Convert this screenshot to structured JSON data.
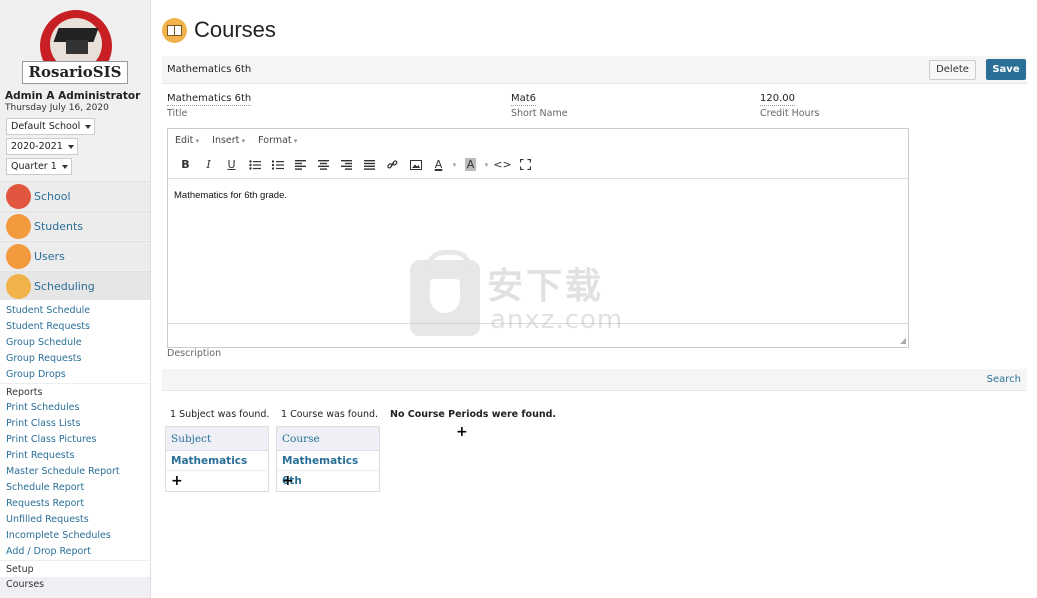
{
  "app": {
    "logo_text": "RosarioSIS"
  },
  "user": {
    "name": "Admin A Administrator",
    "date": "Thursday July 16, 2020"
  },
  "selects": {
    "school": "Default School",
    "year": "2020-2021",
    "quarter": "Quarter 1"
  },
  "menu": {
    "items": [
      {
        "label": "School",
        "icon": "school-icon",
        "color": "#e2553f"
      },
      {
        "label": "Students",
        "icon": "students-icon",
        "color": "#f39a3e"
      },
      {
        "label": "Users",
        "icon": "users-icon",
        "color": "#f39a3e"
      },
      {
        "label": "Scheduling",
        "icon": "scheduling-icon",
        "color": "#f2b24b"
      }
    ],
    "scheduling_links": [
      "Student Schedule",
      "Student Requests",
      "Group Schedule",
      "Group Requests",
      "Group Drops"
    ],
    "reports_heading": "Reports",
    "reports_links": [
      "Print Schedules",
      "Print Class Lists",
      "Print Class Pictures",
      "Print Requests",
      "Master Schedule Report",
      "Schedule Report",
      "Requests Report",
      "Unfilled Requests",
      "Incomplete Schedules",
      "Add / Drop Report"
    ],
    "setup_heading": "Setup",
    "setup_links": [
      "Courses"
    ]
  },
  "page": {
    "title": "Courses",
    "title_icon": "book-icon"
  },
  "course_form": {
    "header_title": "Mathematics 6th",
    "delete_label": "Delete",
    "save_label": "Save",
    "title_value": "Mathematics 6th",
    "title_label": "Title",
    "short_name_value": "Mat6",
    "short_name_label": "Short Name",
    "credit_hours_value": "120.00",
    "credit_hours_label": "Credit Hours",
    "description_label": "Description"
  },
  "editor": {
    "menus": [
      "Edit",
      "Insert",
      "Format"
    ],
    "content": "Mathematics for 6th grade.",
    "toolbar": [
      "bold",
      "italic",
      "underline",
      "bullet-list",
      "numbered-list",
      "align-left",
      "align-center",
      "align-right",
      "align-justify",
      "link",
      "image",
      "text-color",
      "background-color",
      "source-code",
      "fullscreen"
    ]
  },
  "search": {
    "label": "Search"
  },
  "results": {
    "subjects_found": "1 Subject was found.",
    "courses_found": "1 Course was found.",
    "periods_found": "No Course Periods were found.",
    "subject_header": "Subject",
    "subject_value": "Mathematics",
    "course_header": "Course",
    "course_value": "Mathematics 6th",
    "add_symbol": "+"
  },
  "watermark": {
    "cn": "安下载",
    "en": "anxz.com"
  }
}
